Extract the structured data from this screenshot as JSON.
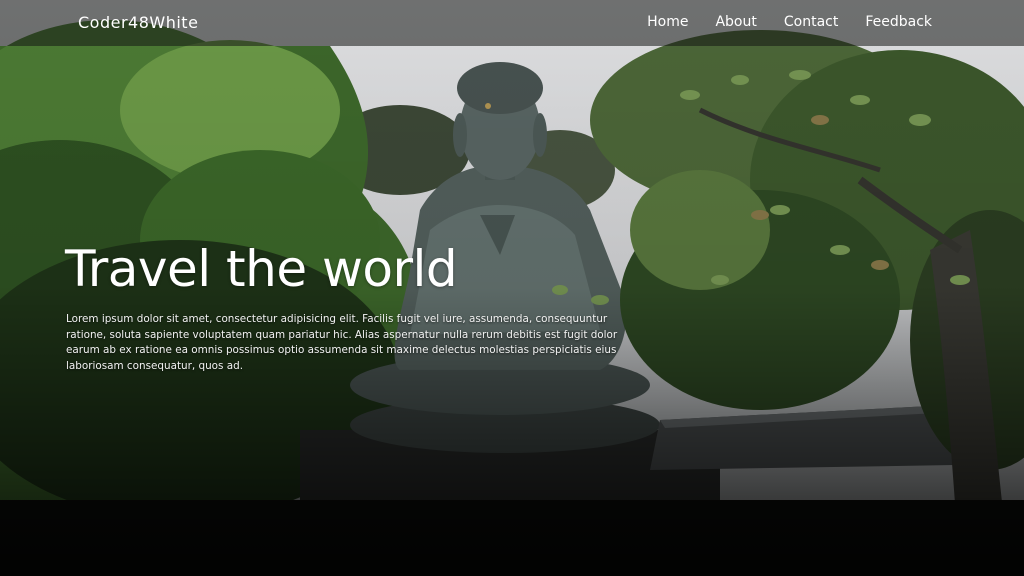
{
  "navbar": {
    "brand": "Coder48White",
    "links": [
      "Home",
      "About",
      "Contact",
      "Feedback"
    ]
  },
  "hero": {
    "title": "Travel the world",
    "description": "Lorem ipsum dolor sit amet, consectetur adipisicing elit. Facilis fugit vel iure, assumenda, consequuntur ratione, soluta sapiente voluptatem quam pariatur hic. Alias aspernatur nulla rerum debitis est fugit dolor earum ab ex ratione ea omnis possimus optio assumenda sit maxime delectus molestias perspiciatis eius laboriosam consequatur, quos ad.",
    "background": "buddha-statue-among-trees-image"
  },
  "colors": {
    "text": "#ffffff",
    "navbar_bg": "#141614"
  }
}
